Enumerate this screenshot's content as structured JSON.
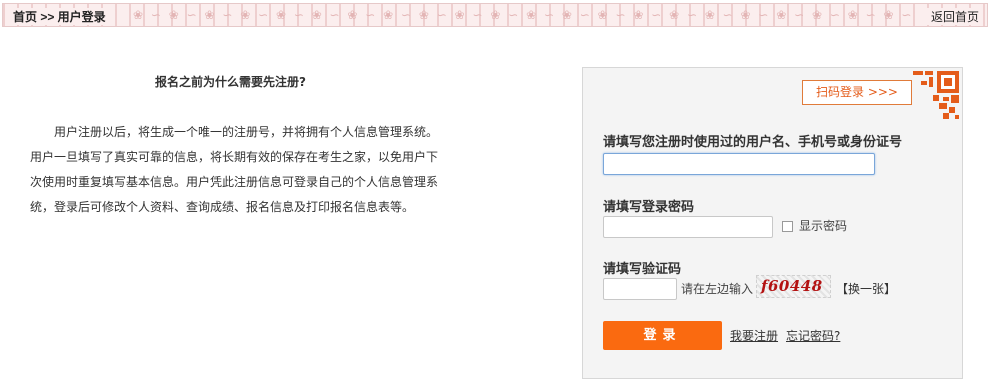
{
  "topbar": {
    "breadcrumb": "首页 >> 用户登录",
    "back_link": "返回首页"
  },
  "faq": {
    "title": "报名之前为什么需要先注册?",
    "body": "用户注册以后，将生成一个唯一的注册号，并将拥有个人信息管理系统。用户一旦填写了真实可靠的信息，将长期有效的保存在考生之家，以免用户下次使用时重复填写基本信息。用户凭此注册信息可登录自己的个人信息管理系统，登录后可修改个人资料、查询成绩、报名信息及打印报名信息表等。"
  },
  "login": {
    "qr_button": "扫码登录  >>>",
    "username_label": "请填写您注册时使用过的用户名、手机号或身份证号",
    "username_value": "",
    "password_label": "请填写登录密码",
    "password_value": "",
    "show_password": "显示密码",
    "captcha_label": "请填写验证码",
    "captcha_value": "",
    "captcha_hint": "请在左边输入",
    "captcha_text": "f60448",
    "captcha_refresh": "【换一张】",
    "login_button": "登录",
    "register_link": "我要注册",
    "forgot_link": "忘记密码?"
  },
  "colors": {
    "accent": "#fa6a10",
    "topbar_bg": "#fbeeee",
    "panel_bg": "#f4f4f4"
  }
}
